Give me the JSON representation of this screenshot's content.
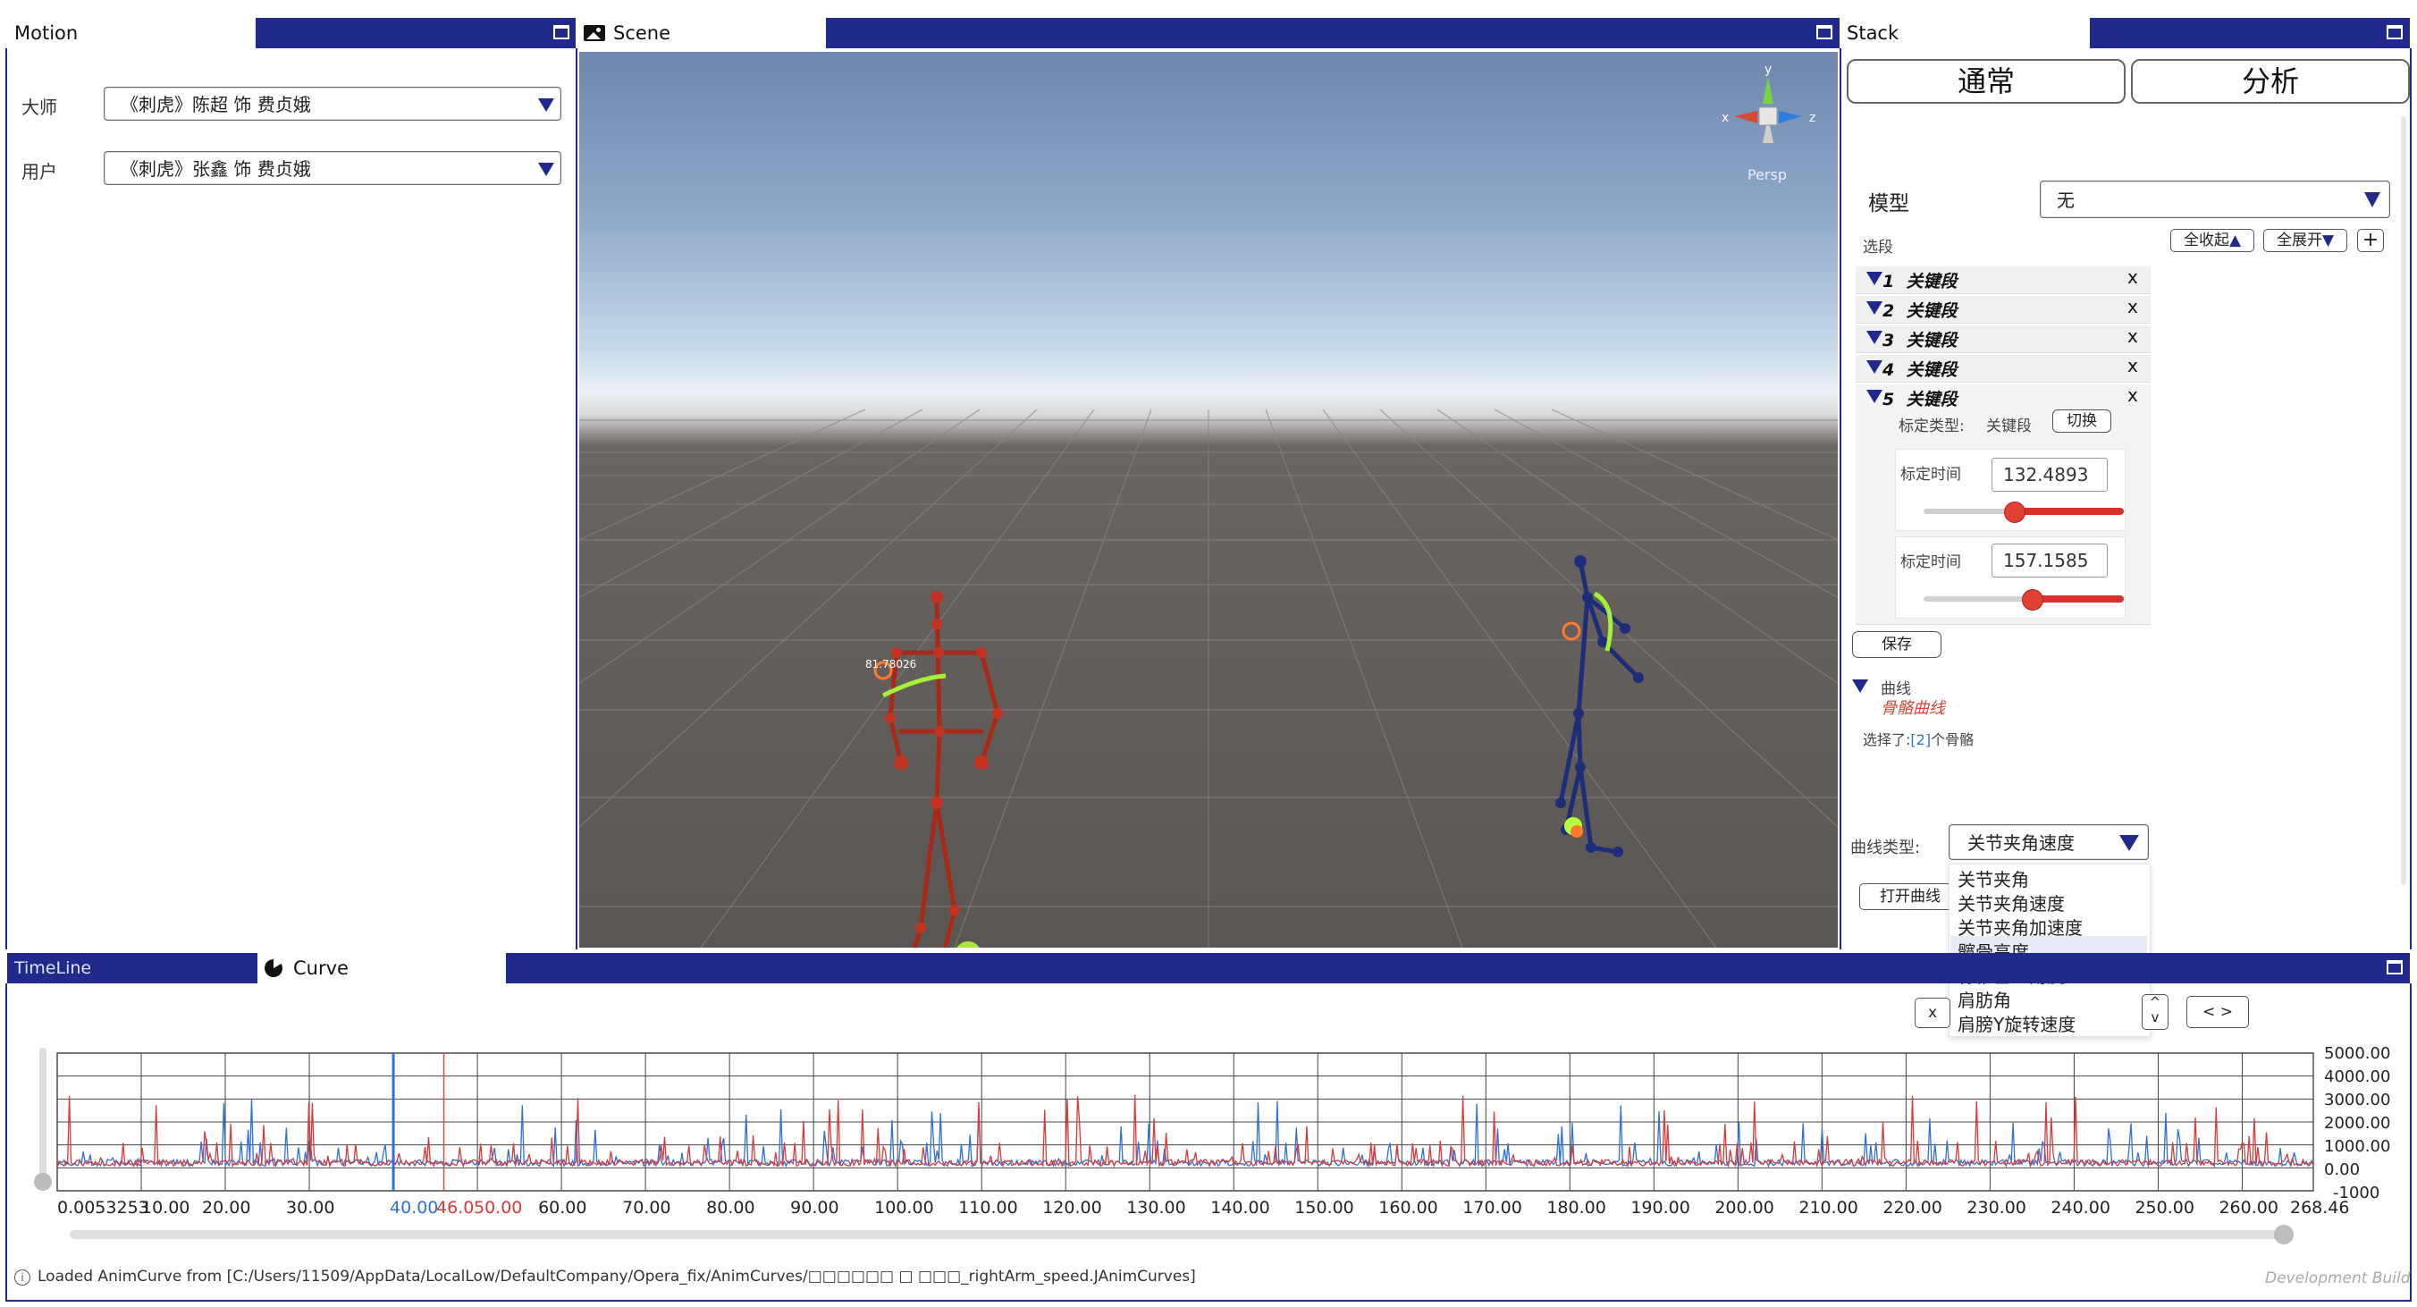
{
  "motion": {
    "tab": "Motion",
    "master_label": "大师",
    "master_value": "《刺虎》陈超 饰 费贞娥",
    "user_label": "用户",
    "user_value": "《刺虎》张鑫 饰 费贞娥"
  },
  "scene": {
    "tab": "Scene",
    "gizmo_label": "Persp",
    "axis_y": "y",
    "axis_x": "x",
    "axis_z": "z",
    "angle_label": "81.78026"
  },
  "stack": {
    "tab": "Stack",
    "btn_normal": "通常",
    "btn_analyze": "分析",
    "model_label": "模型",
    "model_value": "无",
    "segments_label": "选段",
    "collapse_all": "全收起",
    "expand_all": "全展开",
    "add": "+",
    "segments": [
      {
        "num": "1",
        "name": "关键段"
      },
      {
        "num": "2",
        "name": "关键段"
      },
      {
        "num": "3",
        "name": "关键段"
      },
      {
        "num": "4",
        "name": "关键段"
      },
      {
        "num": "5",
        "name": "关键段"
      }
    ],
    "close": "x",
    "mark_type_label": "标定类型:",
    "mark_type_value": "关键段",
    "switch_btn": "切换",
    "time1_label": "标定时间",
    "time1_value": "132.4893",
    "time1_fraction": 0.45,
    "time2_label": "标定时间",
    "time2_value": "157.1585",
    "time2_fraction": 0.54,
    "save_btn": "保存",
    "curve_section": "曲线",
    "bone_curve": "骨骼曲线",
    "selected_prefix": "选择了:",
    "selected_count": "[2]",
    "selected_suffix": "个骨骼",
    "curve_type_label": "曲线类型:",
    "curve_type_value": "关节夹角速度",
    "open_curve_btn": "打开曲线",
    "curve_type_options": [
      "关节夹角",
      "关节夹角速度",
      "关节夹角加速度",
      "髋骨高度",
      "脊椎垂直角度",
      "肩肪角",
      "肩膀Y旋转速度"
    ],
    "highlighted_option": "髋骨高度"
  },
  "bottom": {
    "tab_timeline": "TimeLine",
    "tab_curve": "Curve",
    "ctrl_x": "x",
    "ctrl_caret": "^",
    "ctrl_caret_down": "v",
    "ctrl_nav": "< >"
  },
  "chart_data": {
    "type": "line",
    "y_ticks": [
      "5000.00",
      "4000.00",
      "3000.00",
      "2000.00",
      "1000.00",
      "0.00",
      "-1000"
    ],
    "x_ticks": [
      "0.00",
      "20.00",
      "30.00",
      "40.00",
      "60.00",
      "70.00",
      "80.00",
      "90.00",
      "100.00",
      "110.00",
      "120.00",
      "130.00",
      "140.00",
      "150.00",
      "160.00",
      "170.00",
      "180.00",
      "190.00",
      "200.00",
      "210.00",
      "220.00",
      "230.00",
      "240.00",
      "250.00",
      "260.00",
      "268.46"
    ],
    "x_overlap_left": "0.0053253",
    "x_overlap_left2": "10.00",
    "x_blue_marker_label": "40.00",
    "x_red_marker_label": "46.0",
    "x_overlap_mid": "50.00",
    "xlim": [
      0,
      268.46
    ],
    "ylim": [
      -1000,
      5000
    ],
    "blue_marker_x": 40.0,
    "red_marker_x": 46.0,
    "series": [
      {
        "color": "#2f6fd6"
      },
      {
        "color": "#d63a3a"
      }
    ]
  },
  "status": {
    "message": "Loaded AnimCurve from [C:/Users/11509/AppData/LocalLow/DefaultCompany/Opera_fix/AnimCurves/□□□□□□ □ □□□_rightArm_speed.JAnimCurves]",
    "build": "Development Build"
  }
}
